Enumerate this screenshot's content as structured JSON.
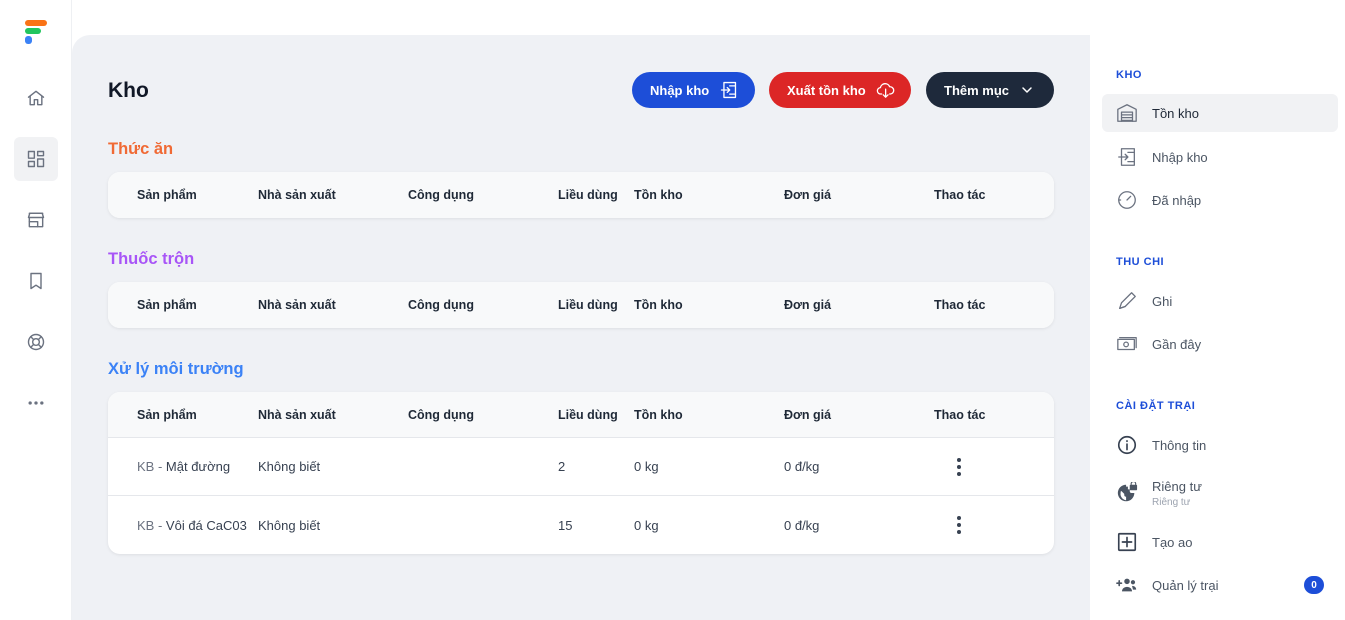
{
  "page": {
    "title": "Kho"
  },
  "actions": {
    "import_label": "Nhập kho",
    "export_label": "Xuất tồn kho",
    "more_label": "Thêm mục"
  },
  "table_headers": [
    "Sản phẩm",
    "Nhà sản xuất",
    "Công dụng",
    "Liều dùng",
    "Tồn kho",
    "Đơn giá",
    "Thao tác"
  ],
  "sections": [
    {
      "title": "Thức ăn",
      "color": "#f06a35",
      "rows": []
    },
    {
      "title": "Thuốc trộn",
      "color": "#a855f7",
      "rows": []
    },
    {
      "title": "Xử lý môi trường",
      "color": "#3b82f6",
      "rows": [
        {
          "prefix": "KB -",
          "product": "Mật đường",
          "manufacturer": "Không biết",
          "usage": "",
          "dosage": "2",
          "stock": "0 kg",
          "price": "0 đ/kg"
        },
        {
          "prefix": "KB -",
          "product": "Vôi đá CaC03",
          "manufacturer": "Không biết",
          "usage": "",
          "dosage": "15",
          "stock": "0 kg",
          "price": "0 đ/kg"
        }
      ]
    }
  ],
  "sidebar": {
    "groups": [
      {
        "heading": "KHO",
        "items": [
          {
            "label": "Tồn kho",
            "icon": "warehouse-icon",
            "active": true
          },
          {
            "label": "Nhập kho",
            "icon": "import-icon"
          },
          {
            "label": "Đã nhập",
            "icon": "history-icon"
          }
        ]
      },
      {
        "heading": "THU CHI",
        "items": [
          {
            "label": "Ghi",
            "icon": "pencil-icon"
          },
          {
            "label": "Gần đây",
            "icon": "money-icon"
          }
        ]
      },
      {
        "heading": "CÀI ĐẶT TRẠI",
        "items": [
          {
            "label": "Thông tin",
            "icon": "info-icon"
          },
          {
            "label": "Riêng tư",
            "sublabel": "Riêng tư",
            "icon": "globe-lock-icon"
          },
          {
            "label": "Tạo ao",
            "icon": "add-box-icon"
          },
          {
            "label": "Quản lý trại",
            "icon": "group-add-icon",
            "badge": "0"
          }
        ]
      }
    ]
  },
  "rail": [
    "home-icon",
    "dashboard-icon",
    "store-icon",
    "bookmark-icon",
    "lifebuoy-icon",
    "more-horizontal-icon"
  ],
  "colors": {
    "primary": "#1d4ed8",
    "danger": "#dc2626",
    "dark": "#1e293b"
  }
}
